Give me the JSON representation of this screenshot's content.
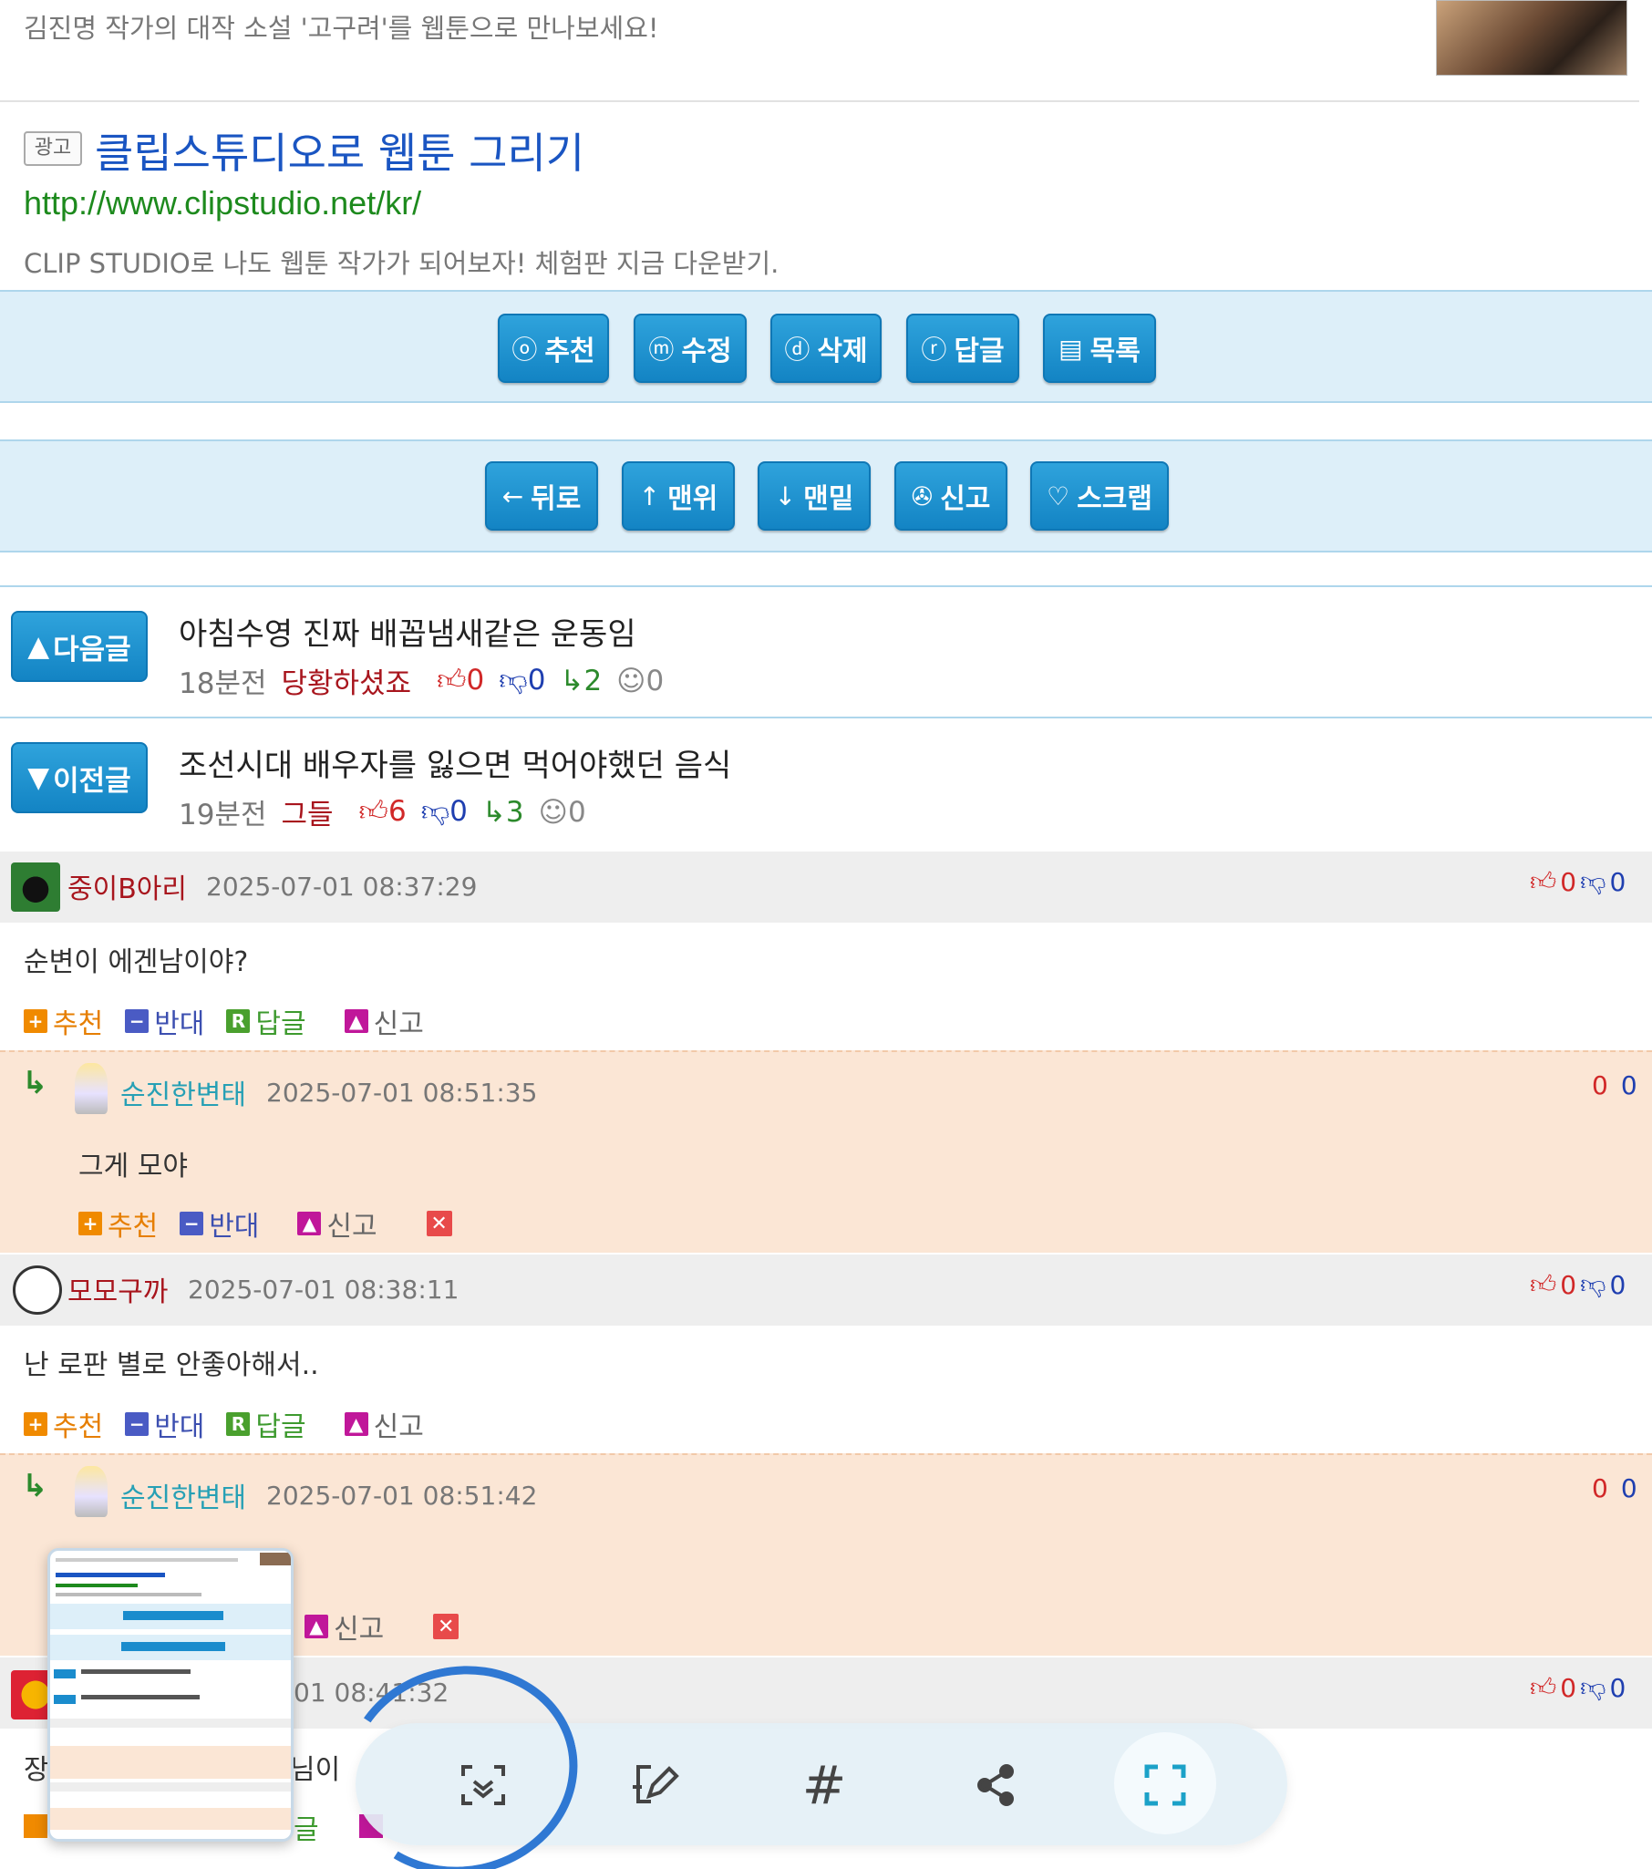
{
  "ad_prev": {
    "description": "김진명 작가의 대작 소설 '고구려'를 웹툰으로 만나보세요!"
  },
  "ad": {
    "tag": "광고",
    "title": "클립스튜디오로 웹툰 그리기",
    "url": "http://www.clipstudio.net/kr/",
    "description": "CLIP STUDIO로 나도 웹툰 작가가 되어보자! 체험판 지금 다운받기."
  },
  "buttons_top": [
    {
      "icon": "ⓞ",
      "label": "추천"
    },
    {
      "icon": "ⓜ",
      "label": "수정"
    },
    {
      "icon": "ⓓ",
      "label": "삭제"
    },
    {
      "icon": "ⓡ",
      "label": "답글"
    },
    {
      "icon": "▤",
      "label": "목록"
    }
  ],
  "buttons_bottom": [
    {
      "icon": "←",
      "label": "뒤로"
    },
    {
      "icon": "↑",
      "label": "맨위"
    },
    {
      "icon": "↓",
      "label": "맨밑"
    },
    {
      "icon": "✇",
      "label": "신고"
    },
    {
      "icon": "♡",
      "label": "스크랩"
    }
  ],
  "next_post": {
    "button": "다음글",
    "title": "아침수영 진짜 배꼽냄새같은 운동임",
    "time": "18분전",
    "author": "당황하셨죠",
    "up": "0",
    "down": "0",
    "replies": "2",
    "emotes": "0"
  },
  "prev_post": {
    "button": "이전글",
    "title": "조선시대 배우자를 잃으면 먹어야했던 음식",
    "time": "19분전",
    "author": "그들",
    "up": "6",
    "down": "0",
    "replies": "3",
    "emotes": "0"
  },
  "comment_actions": {
    "recommend": "추천",
    "oppose": "반대",
    "reply": "답글",
    "report": "신고"
  },
  "comments": [
    {
      "nick": "중이B아리",
      "date": "2025-07-01 08:37:29",
      "up": "0",
      "down": "0",
      "body": "순변이 에겐남이야?"
    },
    {
      "nick": "모모구까",
      "date": "2025-07-01 08:38:11",
      "up": "0",
      "down": "0",
      "body": "난 로판 별로 안좋아해서.."
    },
    {
      "nick": "",
      "date": "01 08:41:32",
      "up": "0",
      "down": "0",
      "body": "장"
    }
  ],
  "replies": [
    {
      "nick": "순진한변태",
      "date": "2025-07-01 08:51:35",
      "up": "0",
      "down": "0",
      "body": "그게 모야"
    },
    {
      "nick": "순진한변태",
      "date": "2025-07-01 08:51:42",
      "up": "0",
      "down": "0",
      "body": ""
    }
  ],
  "partial": {
    "c3_fragment": "님이",
    "c3_reply": "글"
  },
  "toolbar": {
    "icons": [
      "scan-icon",
      "edit-icon",
      "hashtag-icon",
      "share-icon",
      "capture-frame-icon"
    ]
  },
  "colors": {
    "accent": "#1a8ccd",
    "ad_title": "#1a55c2",
    "nick": "#a8151d",
    "reply_bg": "#fbe6d5",
    "circle": "#2f78d3"
  }
}
